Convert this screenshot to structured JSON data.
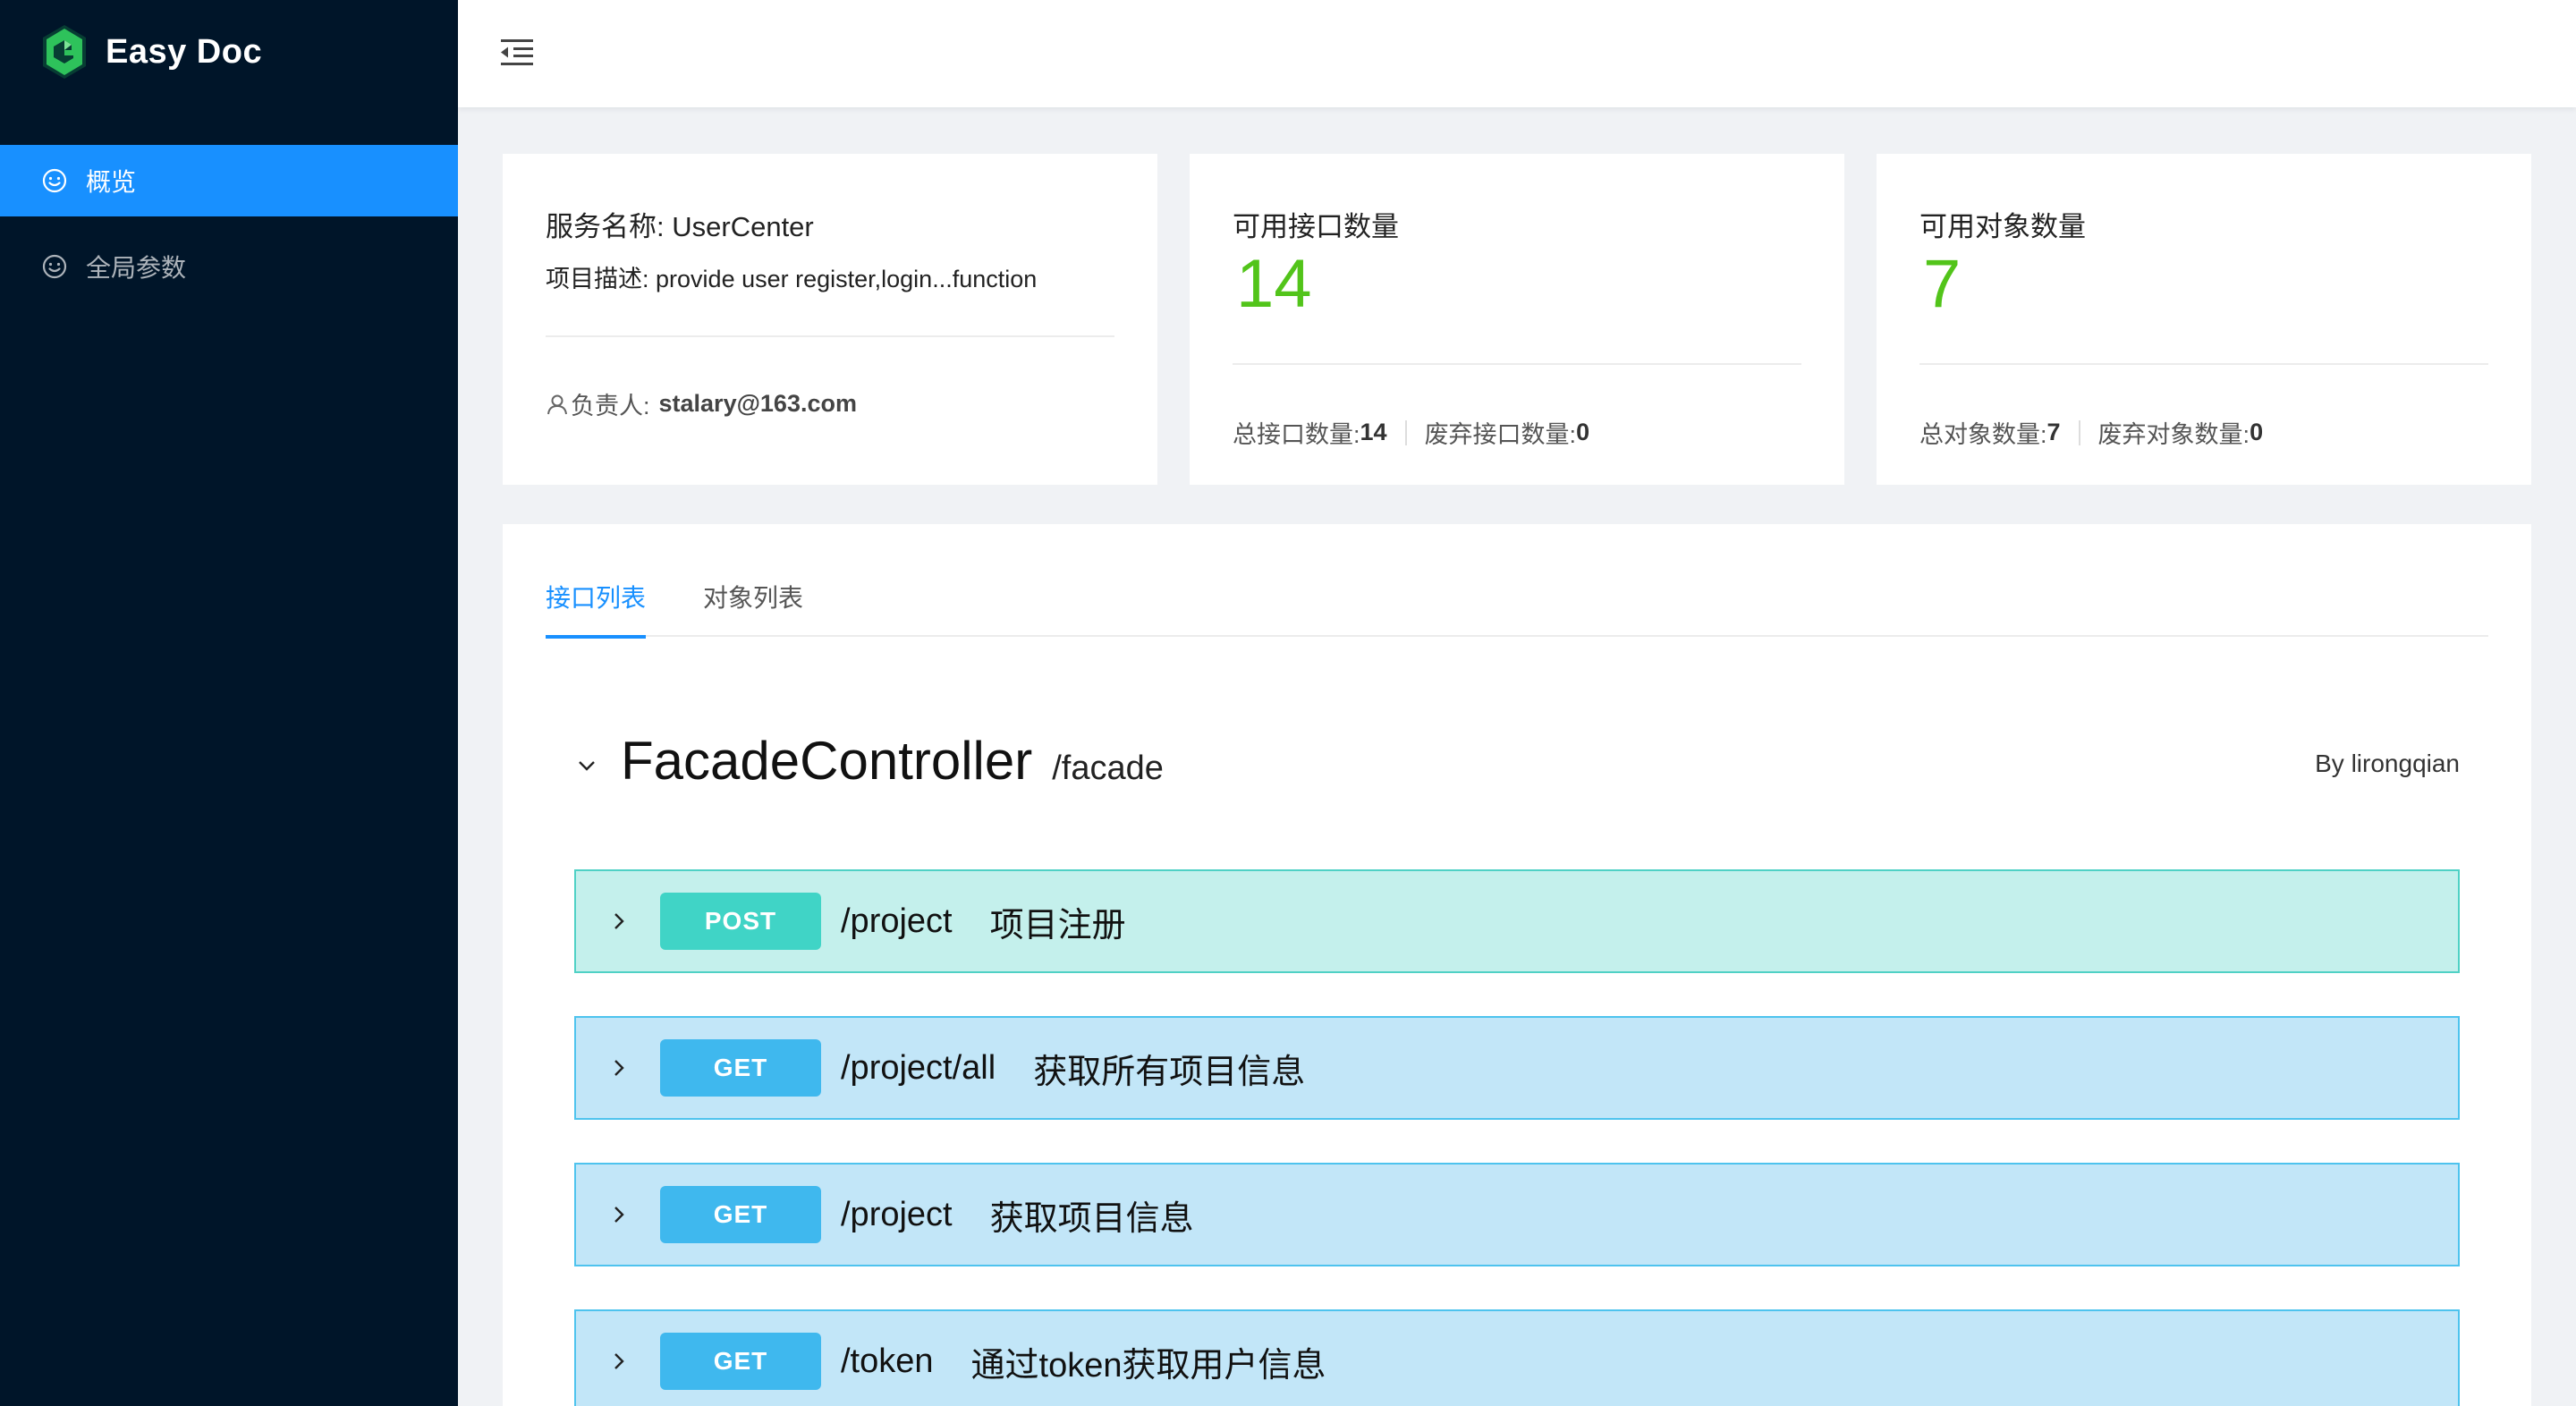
{
  "app": {
    "name": "Easy Doc"
  },
  "sidebar": {
    "items": [
      {
        "label": "概览",
        "icon": "smile-icon",
        "active": true
      },
      {
        "label": "全局参数",
        "icon": "smile-icon",
        "active": false
      }
    ]
  },
  "header": {
    "toggle_icon": "menu-fold-icon"
  },
  "service": {
    "name_label": "服务名称:",
    "name_value": "UserCenter",
    "desc_label": "项目描述:",
    "desc_value": "provide user register,login...function",
    "owner_label": "负责人:",
    "owner_value": "stalary@163.com"
  },
  "interfaces": {
    "title": "可用接口数量",
    "count": "14",
    "total_label": "总接口数量:",
    "total_value": "14",
    "deprecated_label": "废弃接口数量:",
    "deprecated_value": "0"
  },
  "objects": {
    "title": "可用对象数量",
    "count": "7",
    "total_label": "总对象数量:",
    "total_value": "7",
    "deprecated_label": "废弃对象数量:",
    "deprecated_value": "0"
  },
  "tabs": [
    {
      "label": "接口列表",
      "active": true
    },
    {
      "label": "对象列表",
      "active": false
    }
  ],
  "controller": {
    "name": "FacadeController",
    "path": "/facade",
    "author": "By lirongqian"
  },
  "apis": [
    {
      "method": "POST",
      "path": "/project",
      "desc": "项目注册"
    },
    {
      "method": "GET",
      "path": "/project/all",
      "desc": "获取所有项目信息"
    },
    {
      "method": "GET",
      "path": "/project",
      "desc": "获取项目信息"
    },
    {
      "method": "GET",
      "path": "/token",
      "desc": "通过token获取用户信息"
    }
  ],
  "colors": {
    "sidebar_bg": "#001529",
    "accent": "#1890ff",
    "stat_green": "#52c41a",
    "post_bg": "#c4f0ec",
    "get_bg": "#c2e6f8"
  }
}
